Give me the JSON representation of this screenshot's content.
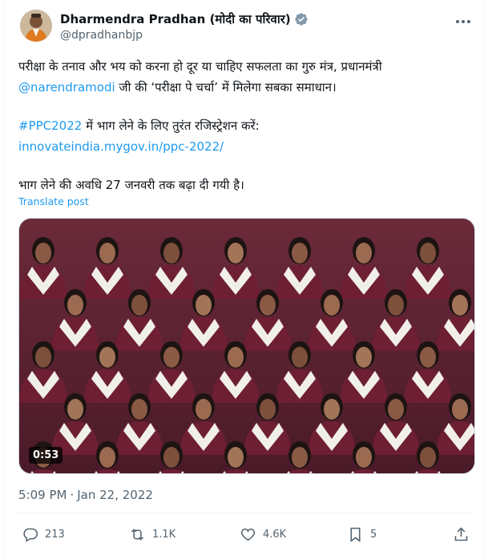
{
  "author": {
    "display_name": "Dharmendra Pradhan (मोदी का परिवार)",
    "handle": "@dpradhanbjp",
    "avatar_icon": "avatar-photo",
    "verified_icon": "verified-badge-icon",
    "verified_color": "#829aab"
  },
  "tweet": {
    "line1_text": "परीक्षा के तनाव और भय को करना हो दूर या चाहिए सफलता का गुरु मंत्र, प्रधानमंत्री",
    "mention": "@narendramodi",
    "line2_rest": " जी की ‘परीक्षा पे चर्चा’ में मिलेगा सबका समाधान।",
    "hashtag": "#PPC2022",
    "line3_rest": " में भाग लेने के लिए तुरंत रजिस्ट्रेशन करें:",
    "url": "innovateindia.mygov.in/ppc-2022/",
    "line5_text": "भाग लेने की अवधि 27 जनवरी तक बढ़ा दी गयी है।",
    "translate_label": "Translate post",
    "link_color": "#1d9bf0"
  },
  "media": {
    "duration": "0:53"
  },
  "meta": {
    "time": "5:09 PM",
    "separator": "·",
    "date": "Jan 22, 2022"
  },
  "actions": {
    "replies": "213",
    "reposts": "1.1K",
    "likes": "4.6K",
    "bookmarks": "5",
    "reply_icon": "reply-icon",
    "repost_icon": "repost-icon",
    "like_icon": "heart-icon",
    "bookmark_icon": "bookmark-icon",
    "share_icon": "share-icon"
  }
}
